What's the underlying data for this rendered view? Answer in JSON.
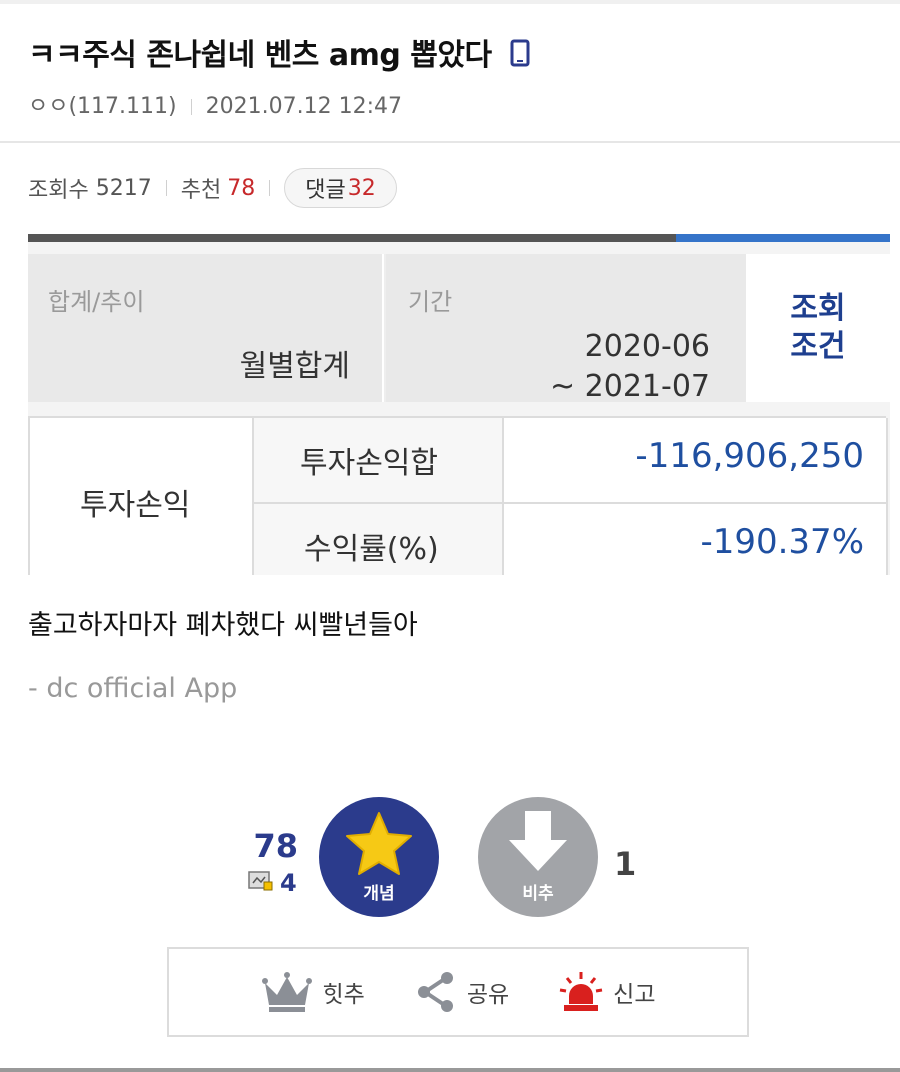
{
  "post": {
    "title": "ㅋㅋ주식 존나쉽네 벤츠 amg 뽑았다",
    "author": "ㅇㅇ(117.111)",
    "datetime": "2021.07.12 12:47"
  },
  "stats": {
    "views_label": "조회수",
    "views": "5217",
    "recommend_label": "추천",
    "recommend": "78",
    "comments_label": "댓글",
    "comments": "32"
  },
  "image": {
    "sum_trend_label": "합계/추이",
    "sum_trend_value": "월별합계",
    "period_label": "기간",
    "period_from": "2020-06",
    "period_to": "~ 2021-07",
    "query_line1": "조회",
    "query_line2": "조건",
    "row_group": "투자손익",
    "row1_label": "투자손익합",
    "row1_value": "-116,906,250",
    "row2_label": "수익률(%)",
    "row2_value": "-190.37%"
  },
  "content": {
    "text": "출고하자마자 폐차했다 씨빨년들아",
    "signature": "- dc official App"
  },
  "votes": {
    "up_count": "78",
    "fix_count": "4",
    "up_label": "개념",
    "down_label": "비추",
    "down_count": "1"
  },
  "actions": {
    "hit_label": "힛추",
    "share_label": "공유",
    "report_label": "신고"
  },
  "colors": {
    "up_button": "#2b3b8c",
    "down_button": "#a2a4a8",
    "star": "#f6c915",
    "report_red": "#d9201e",
    "value_blue": "#1f4fa0"
  }
}
